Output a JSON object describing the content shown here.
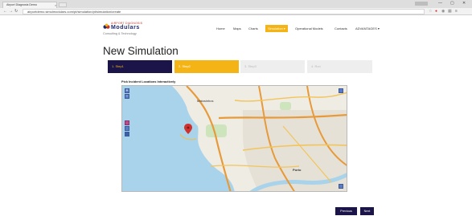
{
  "browser": {
    "tab_title": "Airport Diagnosis Demo",
    "tab_close": "×",
    "url": "airportdemo.simulmodulars.com/pt/simulation/pt/simulation/create",
    "window_controls": [
      "—",
      "▢",
      "✕"
    ]
  },
  "header": {
    "logo_small": "AIRPORT DIAGNOSIS",
    "logo_name": "Modulars",
    "logo_tagline": "Consulting & Technology",
    "nav": [
      {
        "label": "Home"
      },
      {
        "label": "Maps"
      },
      {
        "label": "Charts"
      },
      {
        "label": "Simulation ▾"
      },
      {
        "label": "Operational Models"
      },
      {
        "label": "Contacts"
      },
      {
        "label": "ADVANTAGES ▾"
      }
    ]
  },
  "page": {
    "title": "New Simulation",
    "steps": [
      {
        "label": "1. Step1"
      },
      {
        "label": "2. Step2"
      },
      {
        "label": "3. Step3"
      },
      {
        "label": "4. Run"
      }
    ],
    "map_label": "Pick Incident Locations Interactively",
    "previous_label": "Previous",
    "next_label": "Next"
  },
  "map": {
    "places": [
      "Matosinhos",
      "Porto"
    ],
    "zoom_in": "+",
    "zoom_out": "−"
  },
  "colors": {
    "navy": "#1a1448",
    "accent": "#f5b416",
    "sea": "#a9d3ea",
    "marker": "#d0312d"
  }
}
